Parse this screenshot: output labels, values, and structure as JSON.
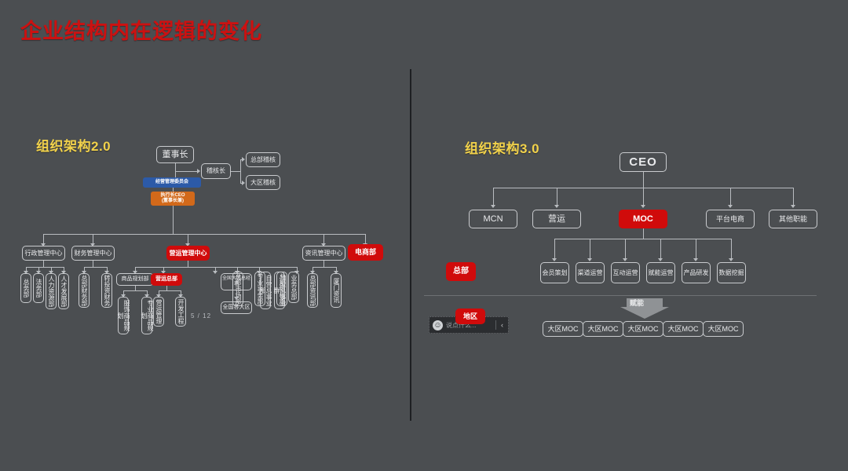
{
  "slide": {
    "title": "企业结构内在逻辑的变化",
    "title_color": "#cc1111",
    "background_color": "#4b4e51",
    "page_indicator": "5 / 12"
  },
  "left_panel": {
    "heading": "组织架构2.0",
    "heading_color": "#f2d24b",
    "top": {
      "chairman": "董事长",
      "audit_chief": "稽核长",
      "audit_hq": "总部稽核",
      "audit_region": "大区稽核",
      "committee": "经营管理委员会",
      "ceo": "执行长CEO\n(董事长兼)"
    },
    "centers": [
      {
        "label": "行政管理中心",
        "color": "gray",
        "children": [
          "总务部",
          "法务部",
          "人力资源部",
          "人才发展部"
        ]
      },
      {
        "label": "财务管理中心",
        "color": "gray",
        "children": [
          "总部财务部",
          "转投资财务"
        ]
      },
      {
        "label": "营运管理中心",
        "color": "red",
        "children": [
          "商品规划部",
          "营运总部",
          "总部市场部",
          "专业事务部",
          "总部稽核部"
        ]
      },
      {
        "label": "资讯管理中心",
        "color": "gray",
        "children": [
          "总部资讯部",
          "厦门资讯"
        ]
      },
      {
        "label": "电商部",
        "color": "red",
        "children": []
      }
    ],
    "sub_children": {
      "商品规划部": [
        "服饰商品规划",
        "专业商品规划"
      ],
      "营运总部": [
        "营运管理",
        "开发工程"
      ]
    },
    "region_branch": {
      "manager": "全国大区总经理",
      "regions": "全国各大区"
    },
    "business_columns": [
      "自营总事业部",
      "加盟总事业群",
      "业务总部"
    ]
  },
  "right_panel": {
    "heading": "组织架构3.0",
    "heading_color": "#f2d24b",
    "ceo": "CEO",
    "level1": [
      {
        "label": "MCN",
        "color": "gray"
      },
      {
        "label": "营运",
        "color": "gray"
      },
      {
        "label": "MOC",
        "color": "red"
      },
      {
        "label": "平台电商",
        "color": "gray"
      },
      {
        "label": "其他职能",
        "color": "gray"
      }
    ],
    "hq_badge": "总部",
    "hq_badge_color": "#d00b0b",
    "moc_functions": [
      "会员策划",
      "渠道运营",
      "互动运营",
      "赋能运营",
      "产品研发",
      "数据挖掘"
    ],
    "arrow_label": "赋能",
    "region_badge": "地区",
    "region_badge_color": "#d00b0b",
    "region_nodes": [
      "大区MOC",
      "大区MOC",
      "大区MOC",
      "大区MOC",
      "大区MOC"
    ]
  },
  "comment_widget": {
    "emoji_icon": "smiley-icon",
    "placeholder": "说点什么...",
    "collapse_icon": "chevron-left-icon"
  }
}
